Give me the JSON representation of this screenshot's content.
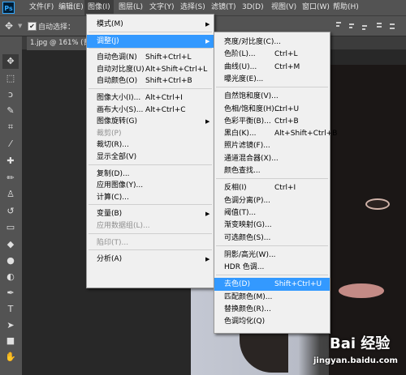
{
  "app": {
    "logo": "Ps"
  },
  "menubar": [
    "文件(F)",
    "编辑(E)",
    "图像(I)",
    "图层(L)",
    "文字(Y)",
    "选择(S)",
    "滤镜(T)",
    "3D(D)",
    "视图(V)",
    "窗口(W)",
    "帮助(H)"
  ],
  "options_bar": {
    "checkbox_mark": "✔",
    "auto_select_label": "自动选择："
  },
  "document_tab": {
    "title": "1.jpg @ 161% (背"
  },
  "image_menu": [
    {
      "label": "模式(M)",
      "submenu": true
    },
    {
      "sep": true
    },
    {
      "label": "调整(J)",
      "submenu": true,
      "highlighted": true
    },
    {
      "sep": true
    },
    {
      "label": "自动色调(N)",
      "shortcut": "Shift+Ctrl+L"
    },
    {
      "label": "自动对比度(U)",
      "shortcut": "Alt+Shift+Ctrl+L"
    },
    {
      "label": "自动颜色(O)",
      "shortcut": "Shift+Ctrl+B"
    },
    {
      "sep": true
    },
    {
      "label": "图像大小(I)...",
      "shortcut": "Alt+Ctrl+I"
    },
    {
      "label": "画布大小(S)...",
      "shortcut": "Alt+Ctrl+C"
    },
    {
      "label": "图像旋转(G)",
      "submenu": true
    },
    {
      "label": "裁剪(P)",
      "disabled": true
    },
    {
      "label": "裁切(R)..."
    },
    {
      "label": "显示全部(V)"
    },
    {
      "sep": true
    },
    {
      "label": "复制(D)..."
    },
    {
      "label": "应用图像(Y)..."
    },
    {
      "label": "计算(C)..."
    },
    {
      "sep": true
    },
    {
      "label": "变量(B)",
      "submenu": true
    },
    {
      "label": "应用数据组(L)...",
      "disabled": true
    },
    {
      "sep": true
    },
    {
      "label": "陷印(T)...",
      "disabled": true
    },
    {
      "sep": true
    },
    {
      "label": "分析(A)",
      "submenu": true
    }
  ],
  "adjust_menu": [
    {
      "label": "亮度/对比度(C)..."
    },
    {
      "label": "色阶(L)...",
      "shortcut": "Ctrl+L"
    },
    {
      "label": "曲线(U)...",
      "shortcut": "Ctrl+M"
    },
    {
      "label": "曝光度(E)..."
    },
    {
      "sep": true
    },
    {
      "label": "自然饱和度(V)..."
    },
    {
      "label": "色相/饱和度(H)...",
      "shortcut": "Ctrl+U"
    },
    {
      "label": "色彩平衡(B)...",
      "shortcut": "Ctrl+B"
    },
    {
      "label": "黑白(K)...",
      "shortcut": "Alt+Shift+Ctrl+B"
    },
    {
      "label": "照片滤镜(F)..."
    },
    {
      "label": "通道混合器(X)..."
    },
    {
      "label": "颜色查找..."
    },
    {
      "sep": true
    },
    {
      "label": "反相(I)",
      "shortcut": "Ctrl+I"
    },
    {
      "label": "色调分离(P)..."
    },
    {
      "label": "阈值(T)..."
    },
    {
      "label": "渐变映射(G)..."
    },
    {
      "label": "可选颜色(S)..."
    },
    {
      "sep": true
    },
    {
      "label": "阴影/高光(W)..."
    },
    {
      "label": "HDR 色调..."
    },
    {
      "sep": true
    },
    {
      "label": "去色(D)",
      "shortcut": "Shift+Ctrl+U",
      "highlighted": true
    },
    {
      "label": "匹配颜色(M)..."
    },
    {
      "label": "替换颜色(R)..."
    },
    {
      "label": "色调均化(Q)"
    }
  ],
  "watermark": {
    "logo": "Bai 经验",
    "url": "jingyan.baidu.com"
  },
  "colors": {
    "highlight": "#3399ff",
    "menu_bg": "#f0f0f0",
    "chrome": "#535353"
  }
}
